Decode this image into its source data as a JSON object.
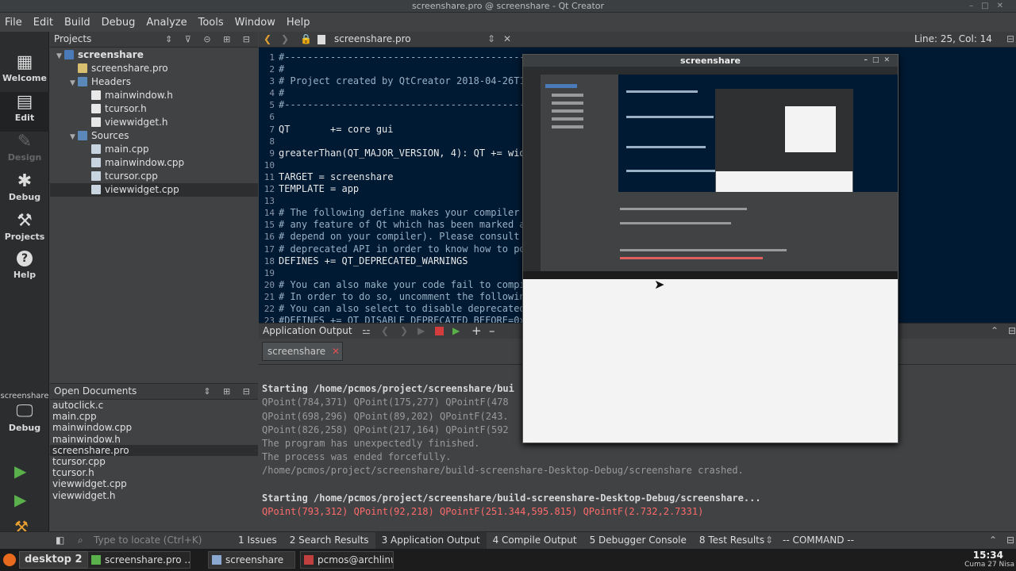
{
  "window": {
    "title": "screenshare.pro @ screenshare - Qt Creator"
  },
  "menu": [
    "File",
    "Edit",
    "Build",
    "Debug",
    "Analyze",
    "Tools",
    "Window",
    "Help"
  ],
  "modes": [
    {
      "label": "Welcome",
      "icon": "grid-icon"
    },
    {
      "label": "Edit",
      "icon": "document-icon"
    },
    {
      "label": "Design",
      "icon": "pencil-icon"
    },
    {
      "label": "Debug",
      "icon": "bug-icon"
    },
    {
      "label": "Projects",
      "icon": "wrench-icon"
    },
    {
      "label": "Help",
      "icon": "help-icon"
    }
  ],
  "kit": {
    "project": "screenshare",
    "mode": "Debug"
  },
  "projects": {
    "title": "Projects",
    "tree": [
      {
        "label": "screenshare",
        "depth": 0,
        "kind": "proj",
        "arrow": "▼",
        "bold": true
      },
      {
        "label": "screenshare.pro",
        "depth": 1,
        "kind": "pro"
      },
      {
        "label": "Headers",
        "depth": 1,
        "kind": "folder",
        "arrow": "▼"
      },
      {
        "label": "mainwindow.h",
        "depth": 2,
        "kind": "h"
      },
      {
        "label": "tcursor.h",
        "depth": 2,
        "kind": "h"
      },
      {
        "label": "viewwidget.h",
        "depth": 2,
        "kind": "h"
      },
      {
        "label": "Sources",
        "depth": 1,
        "kind": "folder",
        "arrow": "▼"
      },
      {
        "label": "main.cpp",
        "depth": 2,
        "kind": "cpp"
      },
      {
        "label": "mainwindow.cpp",
        "depth": 2,
        "kind": "cpp"
      },
      {
        "label": "tcursor.cpp",
        "depth": 2,
        "kind": "cpp"
      },
      {
        "label": "viewwidget.cpp",
        "depth": 2,
        "kind": "cpp",
        "selected": true
      }
    ]
  },
  "open_documents": {
    "title": "Open Documents",
    "items": [
      "autoclick.c",
      "main.cpp",
      "mainwindow.cpp",
      "mainwindow.h",
      "screenshare.pro",
      "tcursor.cpp",
      "tcursor.h",
      "viewwidget.cpp",
      "viewwidget.h"
    ],
    "selected": "screenshare.pro"
  },
  "editor": {
    "file": "screenshare.pro",
    "position": "Line: 25, Col: 14",
    "lines": [
      {
        "n": "1",
        "t": "#-------------------------------------------------",
        "c": true
      },
      {
        "n": "2",
        "t": "#",
        "c": true
      },
      {
        "n": "3",
        "t": "# Project created by QtCreator 2018-04-26T1",
        "c": true
      },
      {
        "n": "4",
        "t": "#",
        "c": true
      },
      {
        "n": "5",
        "t": "#-------------------------------------------------",
        "c": true
      },
      {
        "n": "6",
        "t": ""
      },
      {
        "n": "7",
        "t": "QT       += core gui"
      },
      {
        "n": "8",
        "t": ""
      },
      {
        "n": "9",
        "t": "greaterThan(QT_MAJOR_VERSION, 4): QT += wid"
      },
      {
        "n": "10",
        "t": ""
      },
      {
        "n": "11",
        "t": "TARGET = screenshare"
      },
      {
        "n": "12",
        "t": "TEMPLATE = app"
      },
      {
        "n": "13",
        "t": ""
      },
      {
        "n": "14",
        "t": "# The following define makes your compiler",
        "c": true
      },
      {
        "n": "15",
        "t": "# any feature of Qt which has been marked a",
        "c": true
      },
      {
        "n": "16",
        "t": "# depend on your compiler). Please consult",
        "c": true
      },
      {
        "n": "17",
        "t": "# deprecated API in order to know how to po",
        "c": true
      },
      {
        "n": "18",
        "t": "DEFINES += QT_DEPRECATED_WARNINGS"
      },
      {
        "n": "19",
        "t": ""
      },
      {
        "n": "20",
        "t": "# You can also make your code fail to compi",
        "c": true
      },
      {
        "n": "21",
        "t": "# In order to do so, uncomment the followin",
        "c": true
      },
      {
        "n": "22",
        "t": "# You can also select to disable deprecated",
        "c": true
      },
      {
        "n": "23",
        "t": "#DEFINES += QT_DISABLE_DEPRECATED_BEFORE=0x",
        "c": true
      }
    ]
  },
  "output": {
    "title": "Application Output",
    "tab": "screenshare",
    "lines": [
      {
        "t": "",
        "s": "g"
      },
      {
        "t": "Starting /home/pcmos/project/screenshare/bui",
        "s": "b"
      },
      {
        "t": "QPoint(784,371) QPoint(175,277) QPointF(478",
        "s": "g"
      },
      {
        "t": "QPoint(698,296) QPoint(89,202) QPointF(243.",
        "s": "g"
      },
      {
        "t": "QPoint(826,258) QPoint(217,164) QPointF(592",
        "s": "g"
      },
      {
        "t": "The program has unexpectedly finished.",
        "s": "g"
      },
      {
        "t": "The process was ended forcefully.",
        "s": "g"
      },
      {
        "t": "/home/pcmos/project/screenshare/build-screenshare-Desktop-Debug/screenshare crashed.",
        "s": "g"
      },
      {
        "t": "",
        "s": "g"
      },
      {
        "t": "Starting /home/pcmos/project/screenshare/build-screenshare-Desktop-Debug/screenshare...",
        "s": "b"
      },
      {
        "t": "QPoint(793,312) QPoint(92,218) QPointF(251.344,595.815) QPointF(2.732,2.7331)",
        "s": "r"
      }
    ]
  },
  "status": {
    "locator_placeholder": "Type to locate (Ctrl+K)",
    "panes": [
      "1  Issues",
      "2  Search Results",
      "3  Application Output",
      "4  Compile Output",
      "5  Debugger Console",
      "8  Test Results"
    ],
    "command": "-- COMMAND --"
  },
  "taskbar": {
    "desktop": "desktop 2",
    "apps": [
      "screenshare.pro ...",
      "screenshare",
      "pcmos@archlinu..."
    ],
    "time": "15:34",
    "date": "Cuma 27 Nisa"
  },
  "screenshare_window": {
    "title": "screenshare"
  }
}
